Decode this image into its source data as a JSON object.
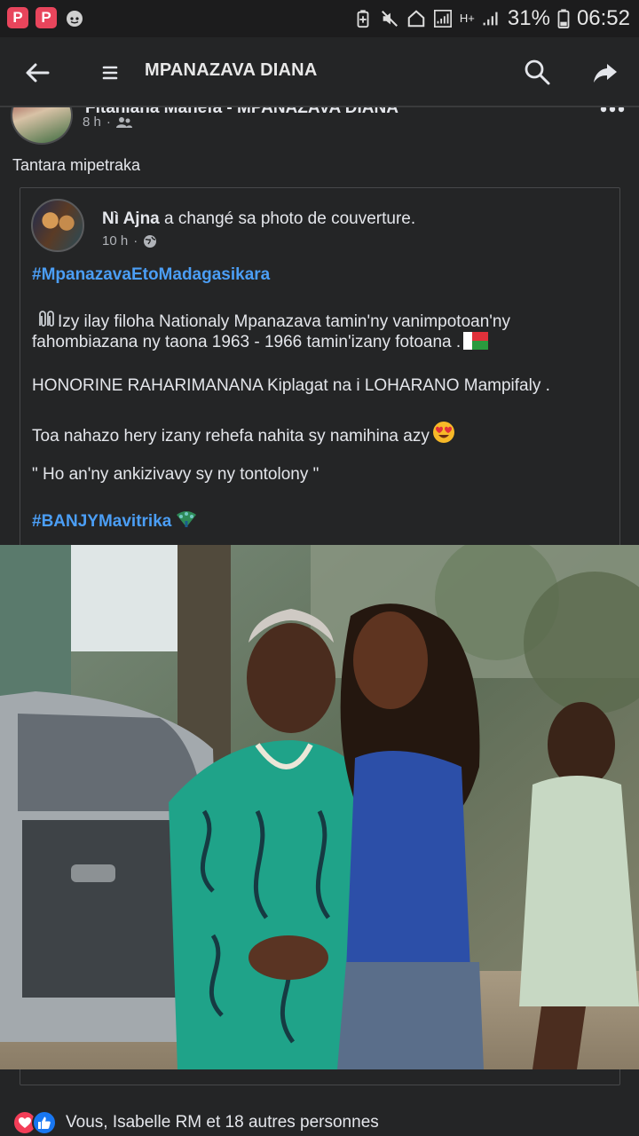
{
  "status_bar": {
    "battery_percent": "31%",
    "time": "06:52",
    "network_label": "H+"
  },
  "app_bar": {
    "title": "MPANAZAVA DIANA",
    "back_icon": "arrow-left-icon",
    "menu_icon": "hamburger-icon",
    "search_icon": "search-icon",
    "share_icon": "share-icon"
  },
  "post": {
    "author_clipped": "Fitahiana Mahefa - MPANAZAVA DIANA",
    "time": "8 h",
    "audience_icon": "friends-icon",
    "text": "Tantara mipetraka",
    "shared": {
      "author": "Nì Ajna",
      "action": "a changé sa photo de couverture.",
      "time": "10 h",
      "audience_icon": "globe-icon",
      "hashtag1": "#MpanazavaEtoMadagasikara",
      "line1": "Izy ilay filoha Nationaly Mpanazava tamin'ny vanimpotoan'ny",
      "line2": "fahombiazana ny taona 1963 - 1966 tamin'izany fotoana .",
      "line3": "HONORINE RAHARIMANANA Kiplagat na i LOHARANO Mampifaly .",
      "line4": "Toa nahazo hery izany rehefa nahita sy namihina azy",
      "line5": "\" Ho an'ny ankizivavy sy ny tontolony \"",
      "hashtag2": "#BANJYMavitrika"
    }
  },
  "reactions": {
    "text": "Vous, Isabelle RM et 18 autres personnes",
    "icons": [
      "love-icon",
      "like-icon"
    ]
  },
  "colors": {
    "background": "#242526",
    "hashtag": "#4b9ef5",
    "love": "#f33e58",
    "like": "#1877f2"
  }
}
